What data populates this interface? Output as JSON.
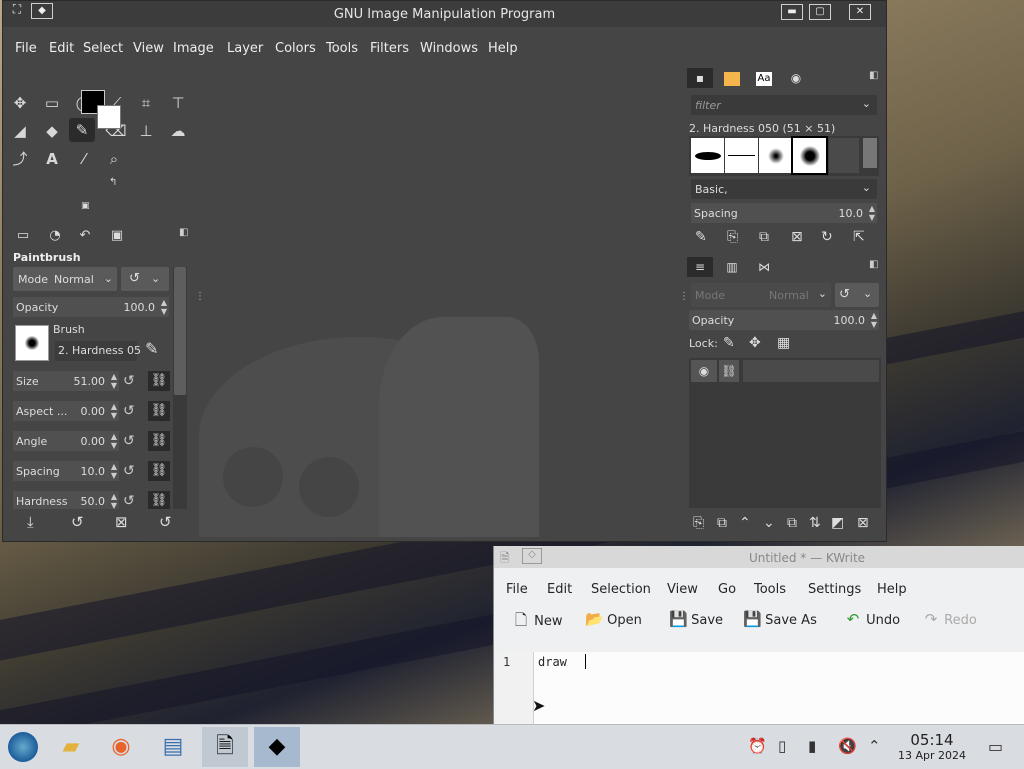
{
  "gimp": {
    "title": "GNU Image Manipulation Program",
    "menu": [
      "File",
      "Edit",
      "Select",
      "View",
      "Image",
      "Layer",
      "Colors",
      "Tools",
      "Filters",
      "Windows",
      "Help"
    ],
    "tool_options": {
      "title": "Paintbrush",
      "mode_label": "Mode",
      "mode_value": "Normal",
      "opacity_label": "Opacity",
      "opacity_value": "100.0",
      "brush_label": "Brush",
      "brush_value": "2. Hardness 05",
      "sliders": [
        {
          "label": "Size",
          "value": "51.00"
        },
        {
          "label": "Aspect ...",
          "value": "0.00"
        },
        {
          "label": "Angle",
          "value": "0.00"
        },
        {
          "label": "Spacing",
          "value": "10.0"
        },
        {
          "label": "Hardness",
          "value": "50.0"
        }
      ]
    },
    "brushes": {
      "filter_placeholder": "filter",
      "selected_brush": "2. Hardness 050 (51 × 51)",
      "tag_value": "Basic,",
      "spacing_label": "Spacing",
      "spacing_value": "10.0"
    },
    "layers": {
      "mode_label": "Mode",
      "mode_value": "Normal",
      "opacity_label": "Opacity",
      "opacity_value": "100.0",
      "lock_label": "Lock:"
    }
  },
  "kwrite": {
    "title": "Untitled * — KWrite",
    "menu": [
      "File",
      "Edit",
      "Selection",
      "View",
      "Go",
      "Tools",
      "Settings",
      "Help"
    ],
    "toolbar": {
      "new": "New",
      "open": "Open",
      "save": "Save",
      "save_as": "Save As",
      "undo": "Undo",
      "redo": "Redo"
    },
    "line_number": "1",
    "content": "draw"
  },
  "taskbar": {
    "time": "05:14",
    "date": "13 Apr 2024"
  }
}
